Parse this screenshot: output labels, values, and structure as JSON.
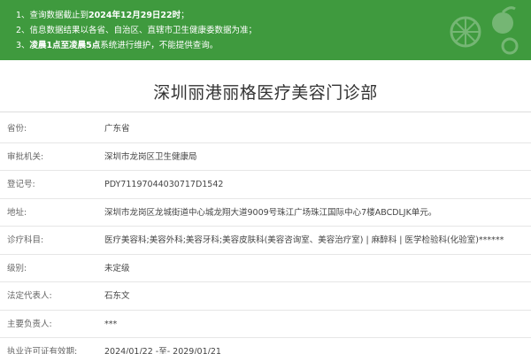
{
  "notice": {
    "items": [
      {
        "prefix": "1、查询数据截止到",
        "bold": "2024年12月29日22时",
        "suffix": "；"
      },
      {
        "prefix": "2、信息数据结果以各省、自治区、直辖市卫生健康委数据为准；",
        "bold": "",
        "suffix": ""
      },
      {
        "prefix": "3、",
        "bold": "凌晨1点至凌晨5点",
        "suffix": "系统进行维护，不能提供查询。"
      }
    ],
    "colors": {
      "background": "#3f9a3e",
      "text": "#ffffff"
    },
    "decoration_icon": "fruit-pattern-icon"
  },
  "clinic": {
    "title": "深圳丽港丽格医疗美容门诊部",
    "fields": [
      {
        "label": "省份:",
        "value": "广东省"
      },
      {
        "label": "审批机关:",
        "value": "深圳市龙岗区卫生健康局"
      },
      {
        "label": "登记号:",
        "value": "PDY71197044030717D1542"
      },
      {
        "label": "地址:",
        "value": "深圳市龙岗区龙城街道中心城龙翔大道9009号珠江广场珠江国际中心7楼ABCDLJK单元。"
      },
      {
        "label": "诊疗科目:",
        "value": "医疗美容科;美容外科;美容牙科;美容皮肤科(美容咨询室、美容治疗室) | 麻醉科 | 医学检验科(化验室)******"
      },
      {
        "label": "级别:",
        "value": "未定级"
      },
      {
        "label": "法定代表人:",
        "value": "石东文"
      },
      {
        "label": "主要负责人:",
        "value": "***"
      },
      {
        "label": "执业许可证有效期:",
        "value": "2024/01/22 -至- 2029/01/21"
      }
    ]
  }
}
